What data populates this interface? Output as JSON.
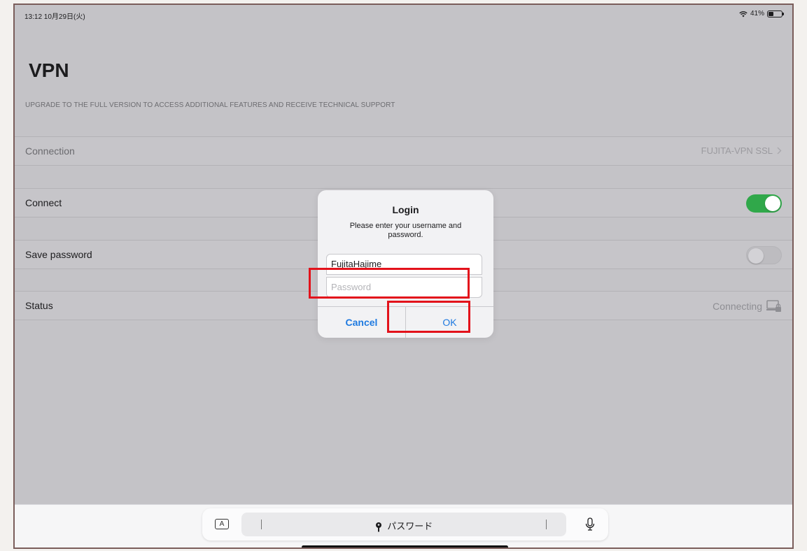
{
  "status_bar": {
    "time": "13:12  10月29日(火)",
    "battery": "41%",
    "battery_level": 0.41
  },
  "page": {
    "title": "VPN",
    "upgrade_notice": "UPGRADE TO THE FULL VERSION TO ACCESS ADDITIONAL FEATURES AND RECEIVE TECHNICAL SUPPORT"
  },
  "rows": {
    "connection_label": "Connection",
    "connection_value": "FUJITA-VPN SSL",
    "connect_label": "Connect",
    "connect_on": true,
    "save_password_label": "Save password",
    "save_password_on": false,
    "status_label": "Status",
    "status_value": "Connecting"
  },
  "dialog": {
    "title": "Login",
    "message": "Please enter your username and password.",
    "username_value": "FujitaHajime",
    "password_placeholder": "Password",
    "cancel_label": "Cancel",
    "ok_label": "OK"
  },
  "keyboard_bar": {
    "a_key": "A",
    "suggestion": "パスワード"
  },
  "colors": {
    "accent": "#1f7ae0",
    "toggle_on": "#30a84a",
    "highlight": "#e3121b"
  }
}
